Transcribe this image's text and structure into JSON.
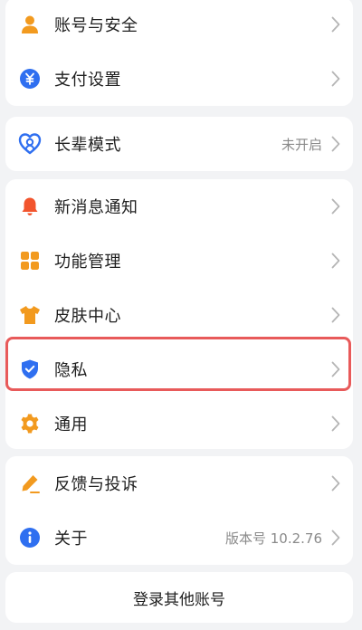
{
  "colors": {
    "accent_orange": "#f29a1f",
    "accent_blue": "#2f6ff0",
    "accent_red": "#f2542d",
    "highlight_red": "#e85a5a"
  },
  "group1": {
    "items": [
      {
        "label": "账号与安全",
        "icon": "user-icon"
      },
      {
        "label": "支付设置",
        "icon": "yuan-coin-icon"
      }
    ]
  },
  "group2": {
    "items": [
      {
        "label": "长辈模式",
        "value": "未开启",
        "icon": "heart-icon"
      }
    ]
  },
  "group3": {
    "items": [
      {
        "label": "新消息通知",
        "icon": "bell-icon"
      },
      {
        "label": "功能管理",
        "icon": "grid-icon"
      },
      {
        "label": "皮肤中心",
        "icon": "shirt-icon"
      },
      {
        "label": "隐私",
        "icon": "shield-check-icon"
      },
      {
        "label": "通用",
        "icon": "gear-icon"
      }
    ]
  },
  "group4": {
    "items": [
      {
        "label": "反馈与投诉",
        "icon": "pen-icon"
      },
      {
        "label": "关于",
        "value": "版本号 10.2.76",
        "icon": "info-icon"
      }
    ]
  },
  "bottom": {
    "login_other": "登录其他账号"
  }
}
